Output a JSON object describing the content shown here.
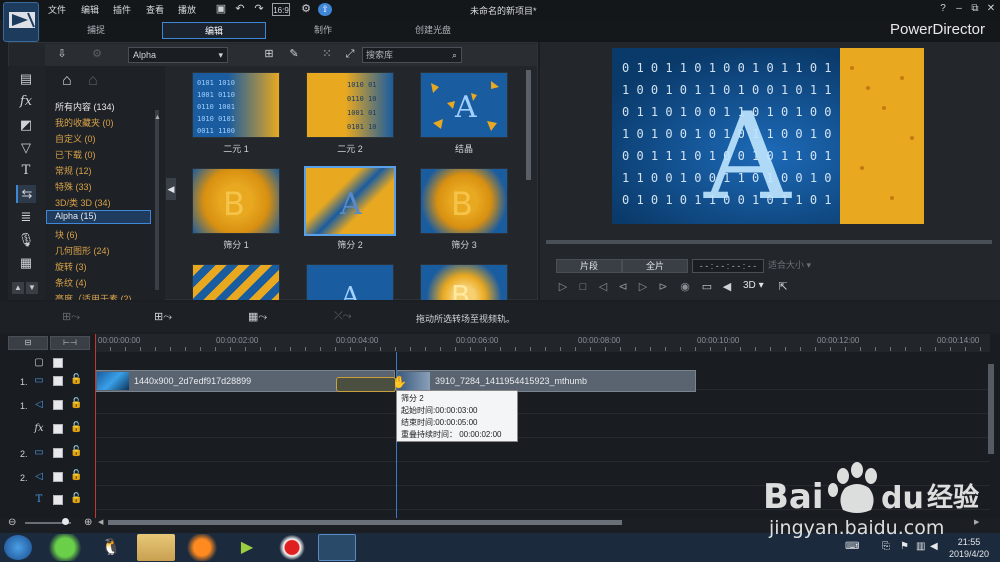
{
  "menu": [
    "文件",
    "编辑",
    "插件",
    "查看",
    "播放"
  ],
  "window_title": "未命名的新项目*",
  "window_buttons": [
    "?",
    "–",
    "⧉",
    "✕"
  ],
  "modes": [
    {
      "label": "捕捉"
    },
    {
      "label": "编辑"
    },
    {
      "label": "制作"
    },
    {
      "label": "创建光盘"
    }
  ],
  "brand": "PowerDirector",
  "library": {
    "filter_select": "Alpha",
    "search_placeholder": "搜索库",
    "categories": [
      "所有内容 (134)",
      "我的收藏夹 (0)",
      "自定义 (0)",
      "已下载 (0)",
      "常规 (12)",
      "特殊 (33)",
      "3D/类 3D (34)",
      "Alpha (15)",
      "块 (6)",
      "几何图形 (24)",
      "旋转 (3)",
      "条纹 (4)",
      "亮度（适用于素 (2)"
    ],
    "selected_category": "Alpha (15)",
    "thumbnails": [
      {
        "label": "二元 1"
      },
      {
        "label": "二元 2"
      },
      {
        "label": "结晶"
      },
      {
        "label": "筛分 1"
      },
      {
        "label": "筛分 2"
      },
      {
        "label": "筛分 3"
      },
      {
        "label": ""
      },
      {
        "label": ""
      },
      {
        "label": ""
      }
    ],
    "selected_thumbnail": "筛分 2"
  },
  "preview": {
    "letter": "A",
    "clip_button": "片段",
    "movie_button": "全片",
    "timecode": "- - : - - : - - : - -",
    "zoom": "适合大小",
    "mode_3d": "3D"
  },
  "timeline": {
    "hint": "拖动所选转场至视频轨。",
    "ruler": [
      "00:00:00:00",
      "00:00:02:00",
      "00:00:04:00",
      "00:00:06:00",
      "00:00:08:00",
      "00:00:10:00",
      "00:00:12:00",
      "00:00:14:00"
    ],
    "tracks": [
      {
        "num": "1.",
        "icon": "video-track-icon"
      },
      {
        "num": "1.",
        "icon": "audio-track-icon"
      },
      {
        "num": "",
        "icon": "fx-track-icon"
      },
      {
        "num": "2.",
        "icon": "video-track-icon"
      },
      {
        "num": "2.",
        "icon": "audio-track-icon"
      },
      {
        "num": "",
        "icon": "title-track-icon"
      }
    ],
    "clip1": "1440x900_2d7edf917d28899",
    "clip2": "3910_7284_1411954415923_mthumb",
    "tooltip": {
      "title": "筛分 2",
      "start": "起始时间:00:00:03:00",
      "end": "结束时间:00:00:05:00",
      "overlap": "重叠持续时间：  00:00:02:00"
    }
  },
  "taskbar": {
    "time": "21:55",
    "date": "2019/4/20"
  },
  "watermark": {
    "brand": "Bai",
    "brand2": "du",
    "brand_cn": "经验",
    "url": "jingyan.baidu.com"
  },
  "colors": {
    "accent": "#3e86d6",
    "category_text": "#d8a24a",
    "gold": "#e8a820",
    "blue": "#1a5ca0"
  }
}
